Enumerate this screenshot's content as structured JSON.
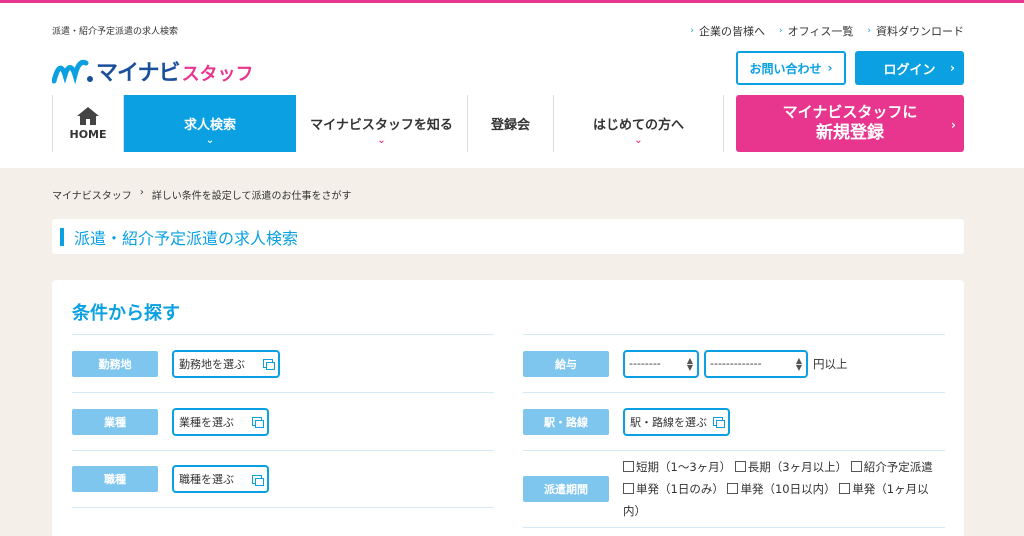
{
  "header": {
    "tagline": "派遣・紹介予定派遣の求人検索",
    "logo_main": "マイナビ",
    "logo_sub": "スタッフ",
    "top_links": [
      "企業の皆様へ",
      "オフィス一覧",
      "資料ダウンロード"
    ],
    "contact_label": "お問い合わせ",
    "login_label": "ログイン",
    "register_line1": "マイナビスタッフに",
    "register_line2": "新規登録"
  },
  "nav": {
    "home": "HOME",
    "search": "求人検索",
    "know": "マイナビスタッフを知る",
    "events": "登録会",
    "first": "はじめての方へ"
  },
  "breadcrumb": {
    "home": "マイナビスタッフ",
    "sep": "›",
    "current": "詳しい条件を設定して派遣のお仕事をさがす"
  },
  "page_title": "派遣・紹介予定派遣の求人検索",
  "search": {
    "heading": "条件から探す",
    "location_label": "勤務地",
    "location_btn": "勤務地を選ぶ",
    "industry_label": "業種",
    "industry_btn": "業種を選ぶ",
    "job_label": "職種",
    "job_btn": "職種を選ぶ",
    "salary_label": "給与",
    "salary_type": "--------",
    "salary_amount": "-------------",
    "salary_suffix": "円以上",
    "station_label": "駅・路線",
    "station_btn": "駅・路線を選ぶ",
    "period_label": "派遣期間",
    "periods": [
      "短期（1〜3ヶ月）",
      "長期（3ヶ月以上）",
      "紹介予定派遣",
      "単発（1日のみ）",
      "単発（10日以内）",
      "単発（1ヶ月以内）"
    ]
  },
  "colors": {
    "brand_blue": "#0aa0e2",
    "brand_pink": "#e8358e",
    "label_blue": "#7fc6ee"
  }
}
